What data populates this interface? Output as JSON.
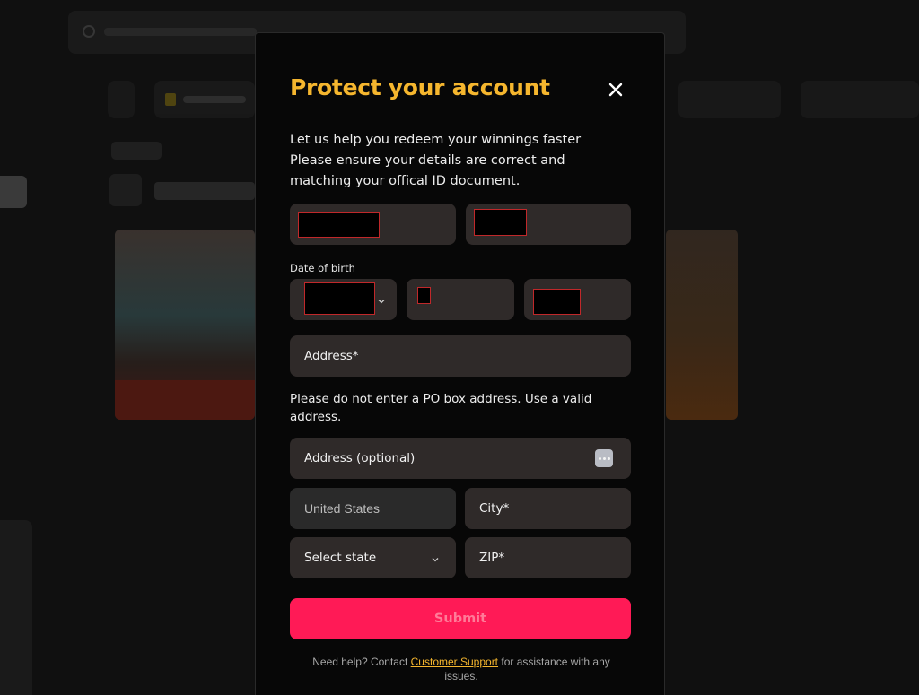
{
  "modal": {
    "title": "Protect your account",
    "intro_lines": [
      "Let us help you redeem your winnings faster",
      "Please ensure your details are correct and",
      "matching your offical ID document."
    ],
    "dob_label": "Date of birth",
    "address_placeholder": "Address*",
    "po_note": "Please do not enter a PO box address. Use a valid address.",
    "address2_placeholder": "Address (optional)",
    "country_value": "United States",
    "city_placeholder": "City*",
    "state_placeholder": "Select state",
    "zip_placeholder": "ZIP*",
    "submit_label": "Submit",
    "help_prefix": "Need help? Contact ",
    "help_link": "Customer Support",
    "help_suffix": " for assistance with any issues."
  },
  "icons": {
    "close": "close-icon",
    "chevron": "chevron-down-icon",
    "more": "more-dots-icon"
  },
  "colors": {
    "accent_title": "#f5b62e",
    "submit_bg": "#ff1a56",
    "field_bg": "#2f2a29",
    "modal_bg": "#070707",
    "redaction_border": "#c0282a"
  }
}
